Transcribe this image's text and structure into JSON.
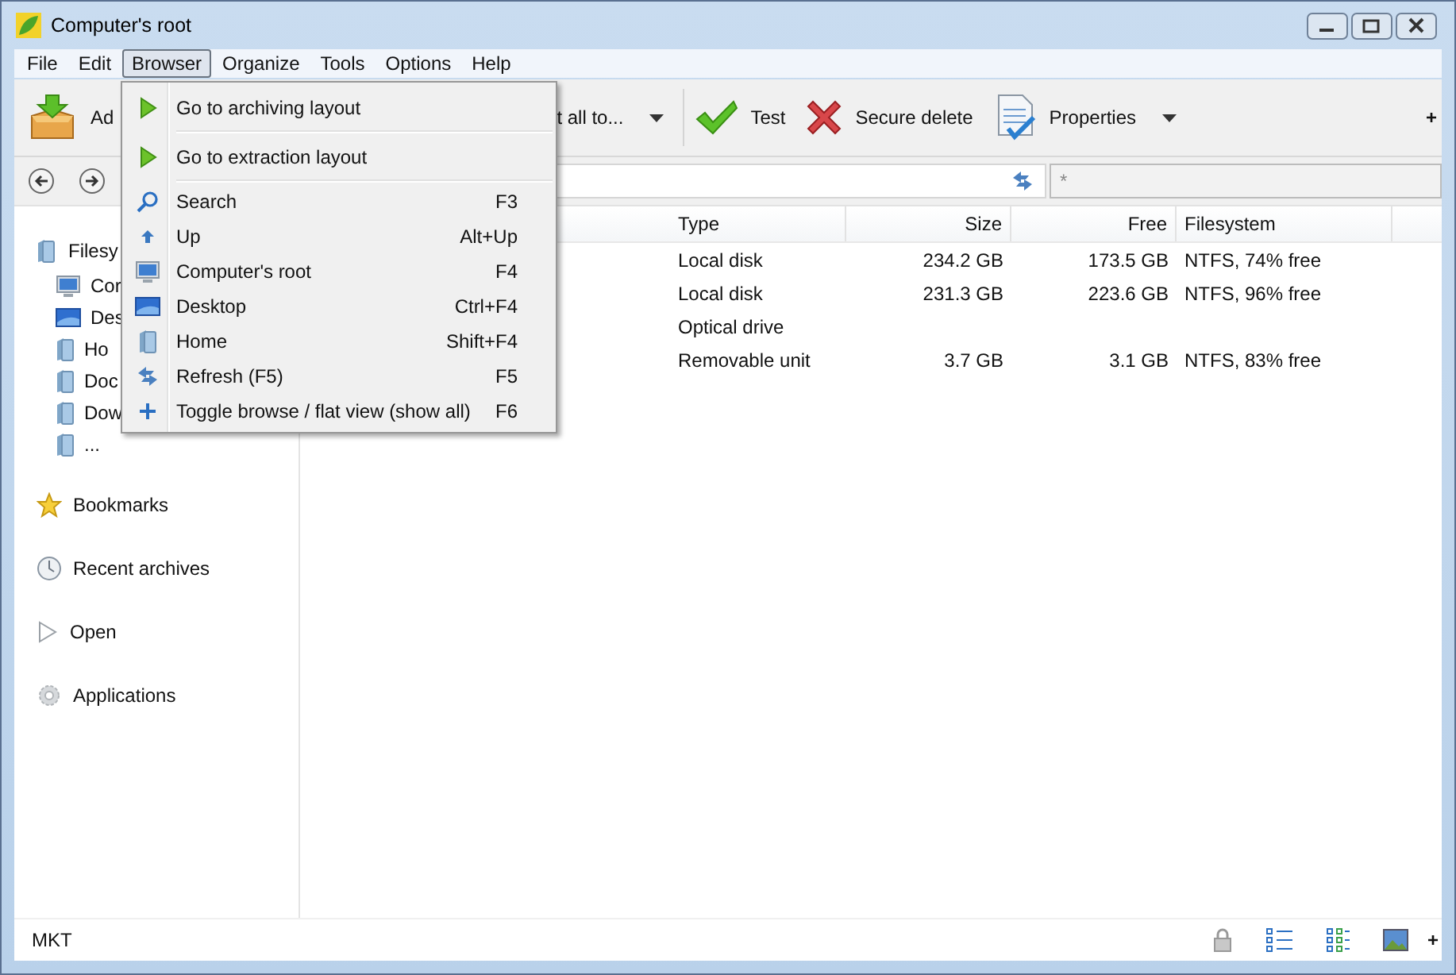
{
  "window": {
    "title": "Computer's root"
  },
  "menubar": [
    {
      "label": "File",
      "selected": false
    },
    {
      "label": "Edit",
      "selected": false
    },
    {
      "label": "Browser",
      "selected": true
    },
    {
      "label": "Organize",
      "selected": false
    },
    {
      "label": "Tools",
      "selected": false
    },
    {
      "label": "Options",
      "selected": false
    },
    {
      "label": "Help",
      "selected": false
    }
  ],
  "toolbar": [
    {
      "kind": "add",
      "label": "Ad"
    },
    {
      "kind": "extract",
      "label": "t all to..."
    },
    {
      "kind": "test",
      "label": "Test"
    },
    {
      "kind": "delete",
      "label": "Secure delete"
    },
    {
      "kind": "properties",
      "label": "Properties"
    }
  ],
  "toolbar_more": "+",
  "filter": {
    "value": "*"
  },
  "sidebar": {
    "tree": [
      {
        "label": "Filesy",
        "children": [
          {
            "label": "Cor",
            "kind": "computer"
          },
          {
            "label": "Des",
            "kind": "desktop"
          },
          {
            "label": "Ho",
            "kind": "folder"
          },
          {
            "label": "Doc",
            "kind": "folder"
          },
          {
            "label": "Dow",
            "kind": "folder"
          },
          {
            "label": "...",
            "kind": "folder"
          }
        ]
      }
    ],
    "items": [
      {
        "kind": "bookmarks",
        "label": "Bookmarks"
      },
      {
        "kind": "recent",
        "label": "Recent archives"
      },
      {
        "kind": "open",
        "label": "Open"
      },
      {
        "kind": "apps",
        "label": "Applications"
      }
    ]
  },
  "table": {
    "columns": [
      "Type",
      "Size",
      "Free",
      "Filesystem"
    ],
    "rows": [
      [
        "Local disk",
        "234.2 GB",
        "173.5 GB",
        "NTFS, 74% free"
      ],
      [
        "Local disk",
        "231.3 GB",
        "223.6 GB",
        "NTFS, 96% free"
      ],
      [
        "Optical drive",
        "",
        "",
        ""
      ],
      [
        "Removable unit",
        "3.7 GB",
        "3.1 GB",
        "NTFS, 83% free"
      ]
    ]
  },
  "menu": {
    "items": [
      {
        "kind": "play",
        "label": "Go to archiving layout",
        "separator_after": true
      },
      {
        "kind": "play",
        "label": "Go to extraction layout",
        "separator_after": true
      },
      {
        "kind": "search",
        "label": "Search",
        "shortcut": "F3",
        "separator_after": false
      },
      {
        "kind": "up",
        "label": "Up",
        "shortcut": "Alt+Up",
        "separator_after": false
      },
      {
        "kind": "computer",
        "label": "Computer's root",
        "shortcut": "F4",
        "separator_after": false
      },
      {
        "kind": "desktop",
        "label": "Desktop",
        "shortcut": "Ctrl+F4",
        "separator_after": false
      },
      {
        "kind": "folder",
        "label": "Home",
        "shortcut": "Shift+F4",
        "separator_after": false
      },
      {
        "kind": "refresh",
        "label": "Refresh (F5)",
        "shortcut": "F5",
        "separator_after": false
      },
      {
        "kind": "plus",
        "label": "Toggle browse / flat view (show all)",
        "shortcut": "F6",
        "separator_after": false
      }
    ]
  },
  "status_bar": {
    "text": "MKT",
    "more": "+"
  }
}
